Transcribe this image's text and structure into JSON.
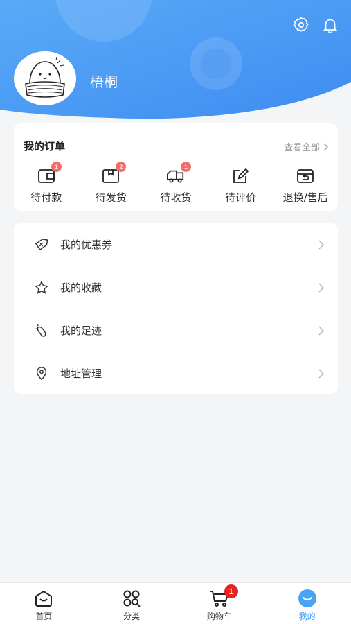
{
  "header": {
    "username": "梧桐",
    "icons": [
      "settings-icon",
      "bell-icon"
    ],
    "gradient": [
      "#5aa9f7",
      "#3f8ef2"
    ]
  },
  "orders": {
    "title": "我的订单",
    "view_all": "查看全部",
    "items": [
      {
        "label": "待付款",
        "icon": "wallet-icon",
        "badge": "1"
      },
      {
        "label": "待发货",
        "icon": "box-icon",
        "badge": "2"
      },
      {
        "label": "待收货",
        "icon": "truck-icon",
        "badge": "1"
      },
      {
        "label": "待评价",
        "icon": "edit-icon",
        "badge": ""
      },
      {
        "label": "退换/售后",
        "icon": "return-icon",
        "badge": ""
      }
    ]
  },
  "menu": {
    "items": [
      {
        "label": "我的优惠券",
        "icon": "coupon-icon"
      },
      {
        "label": "我的收藏",
        "icon": "star-icon"
      },
      {
        "label": "我的足迹",
        "icon": "footprint-icon"
      },
      {
        "label": "地址管理",
        "icon": "location-icon"
      }
    ]
  },
  "tabbar": {
    "items": [
      {
        "label": "首页",
        "icon": "home-icon",
        "active": false
      },
      {
        "label": "分类",
        "icon": "category-icon",
        "active": false
      },
      {
        "label": "购物车",
        "icon": "cart-icon",
        "active": false,
        "badge": "1"
      },
      {
        "label": "我的",
        "icon": "profile-icon",
        "active": true
      }
    ]
  },
  "colors": {
    "accent": "#3b9cf5",
    "badge": "#f36b6b",
    "cart_badge": "#e8231f"
  }
}
